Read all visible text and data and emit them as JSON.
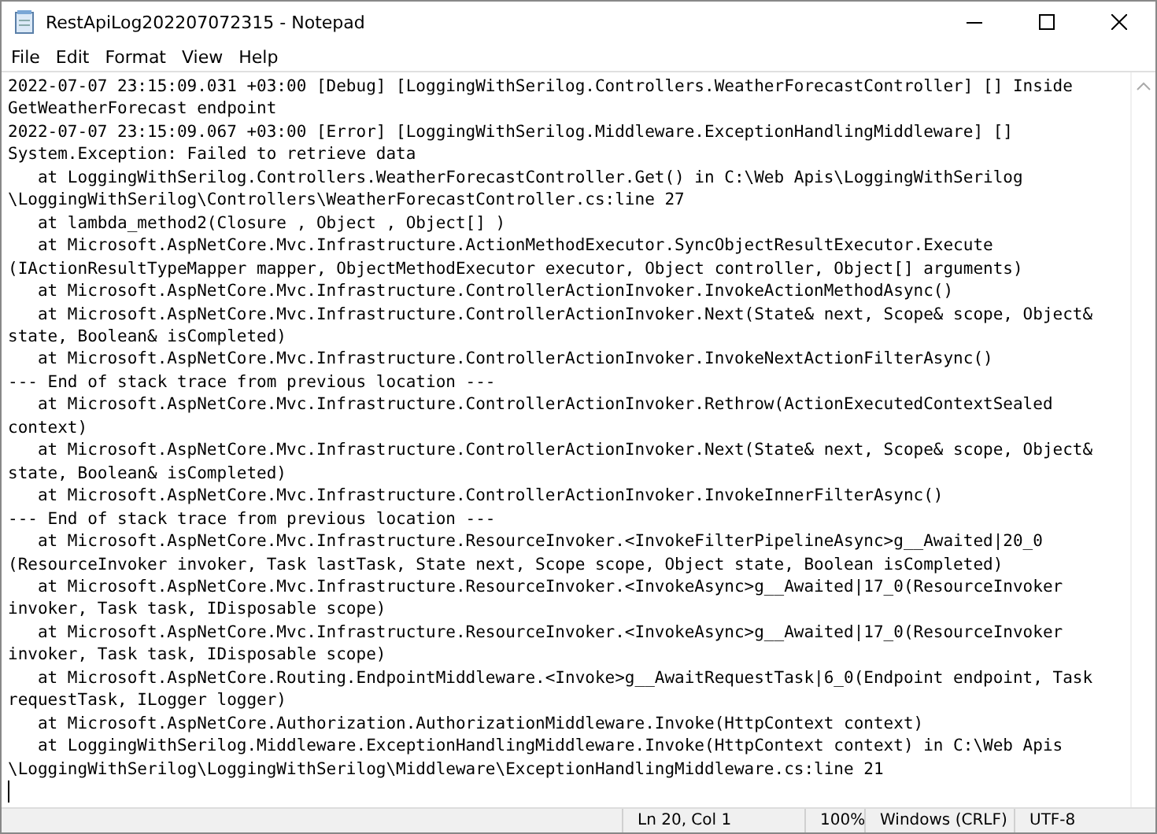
{
  "window": {
    "title": "RestApiLog202207072315 - Notepad"
  },
  "menu": [
    "File",
    "Edit",
    "Format",
    "View",
    "Help"
  ],
  "lines": [
    "2022-07-07 23:15:09.031 +03:00 [Debug] [LoggingWithSerilog.Controllers.WeatherForecastController] [] Inside",
    "GetWeatherForecast endpoint",
    "2022-07-07 23:15:09.067 +03:00 [Error] [LoggingWithSerilog.Middleware.ExceptionHandlingMiddleware] []",
    "System.Exception: Failed to retrieve data",
    "   at LoggingWithSerilog.Controllers.WeatherForecastController.Get() in C:\\Web Apis\\LoggingWithSerilog",
    "\\LoggingWithSerilog\\Controllers\\WeatherForecastController.cs:line 27",
    "   at lambda_method2(Closure , Object , Object[] )",
    "   at Microsoft.AspNetCore.Mvc.Infrastructure.ActionMethodExecutor.SyncObjectResultExecutor.Execute",
    "(IActionResultTypeMapper mapper, ObjectMethodExecutor executor, Object controller, Object[] arguments)",
    "   at Microsoft.AspNetCore.Mvc.Infrastructure.ControllerActionInvoker.InvokeActionMethodAsync()",
    "   at Microsoft.AspNetCore.Mvc.Infrastructure.ControllerActionInvoker.Next(State& next, Scope& scope, Object&",
    "state, Boolean& isCompleted)",
    "   at Microsoft.AspNetCore.Mvc.Infrastructure.ControllerActionInvoker.InvokeNextActionFilterAsync()",
    "--- End of stack trace from previous location ---",
    "   at Microsoft.AspNetCore.Mvc.Infrastructure.ControllerActionInvoker.Rethrow(ActionExecutedContextSealed",
    "context)",
    "   at Microsoft.AspNetCore.Mvc.Infrastructure.ControllerActionInvoker.Next(State& next, Scope& scope, Object&",
    "state, Boolean& isCompleted)",
    "   at Microsoft.AspNetCore.Mvc.Infrastructure.ControllerActionInvoker.InvokeInnerFilterAsync()",
    "--- End of stack trace from previous location ---",
    "   at Microsoft.AspNetCore.Mvc.Infrastructure.ResourceInvoker.<InvokeFilterPipelineAsync>g__Awaited|20_0",
    "(ResourceInvoker invoker, Task lastTask, State next, Scope scope, Object state, Boolean isCompleted)",
    "   at Microsoft.AspNetCore.Mvc.Infrastructure.ResourceInvoker.<InvokeAsync>g__Awaited|17_0(ResourceInvoker",
    "invoker, Task task, IDisposable scope)",
    "   at Microsoft.AspNetCore.Mvc.Infrastructure.ResourceInvoker.<InvokeAsync>g__Awaited|17_0(ResourceInvoker",
    "invoker, Task task, IDisposable scope)",
    "   at Microsoft.AspNetCore.Routing.EndpointMiddleware.<Invoke>g__AwaitRequestTask|6_0(Endpoint endpoint, Task",
    "requestTask, ILogger logger)",
    "   at Microsoft.AspNetCore.Authorization.AuthorizationMiddleware.Invoke(HttpContext context)",
    "   at LoggingWithSerilog.Middleware.ExceptionHandlingMiddleware.Invoke(HttpContext context) in C:\\Web Apis",
    "\\LoggingWithSerilog\\LoggingWithSerilog\\Middleware\\ExceptionHandlingMiddleware.cs:line 21"
  ],
  "status_bar": [
    "Ln 20, Col 1",
    "100%",
    "Windows (CRLF)",
    "UTF-8"
  ]
}
